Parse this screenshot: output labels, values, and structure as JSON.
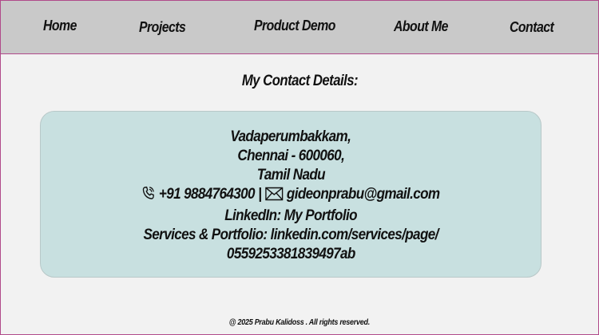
{
  "nav": {
    "items": [
      {
        "label": "Home"
      },
      {
        "label": "Projects"
      },
      {
        "label": "Product Demo"
      },
      {
        "label": "About Me"
      },
      {
        "label": "Contact"
      }
    ]
  },
  "page": {
    "title": "My Contact Details:"
  },
  "contact": {
    "address_line1": "Vadaperumbakkam,",
    "address_line2": "Chennai - 600060,",
    "address_line3": "Tamil Nadu",
    "phone": "+91 9884764300",
    "separator": "|",
    "email": "gideonprabu@gmail.com",
    "linkedin_label": "LinkedIn:",
    "linkedin_link": "My Portfolio",
    "services_label": "Services & Portfolio:",
    "services_link_part1": "linkedin.com/services/page/",
    "services_link_part2": "0559253381839497ab"
  },
  "footer": {
    "text": "@ 2025 Prabu Kalidoss . All rights reserved."
  },
  "icons": {
    "phone": "phone-icon",
    "email": "mail-icon"
  },
  "colors": {
    "navbar_bg": "#c9c9c9",
    "page_bg": "#f2f2f2",
    "card_bg": "#c8e0e0",
    "border_accent": "#b04a8a"
  }
}
